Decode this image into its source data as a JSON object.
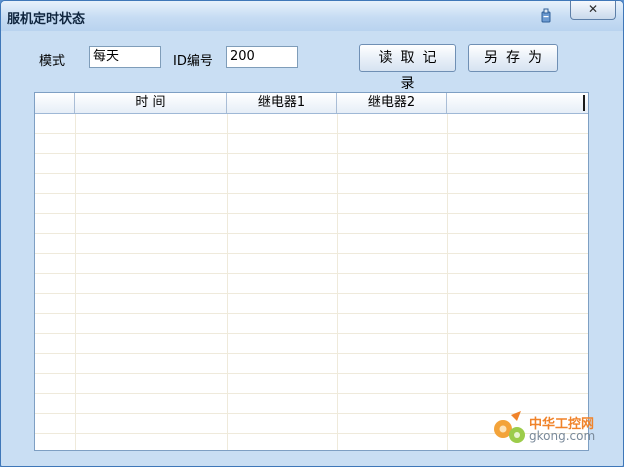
{
  "window": {
    "title": "服机定时状态",
    "close_label": "✕"
  },
  "form": {
    "mode_label": "模式",
    "mode_value": "每天",
    "id_label": "ID编号",
    "id_value": "200"
  },
  "buttons": {
    "read_records": "读取记录",
    "save_as": "另存为"
  },
  "table": {
    "columns": [
      "",
      "时 间",
      "继电器1",
      "继电器2",
      ""
    ],
    "rows": []
  },
  "watermark": {
    "text1": "中华工控网",
    "text2": "gkong.com"
  },
  "colors": {
    "window_bg": "#c9def3",
    "grid_line": "#efeadb",
    "title_text": "#10263f",
    "watermark_orange": "#f0832a"
  }
}
